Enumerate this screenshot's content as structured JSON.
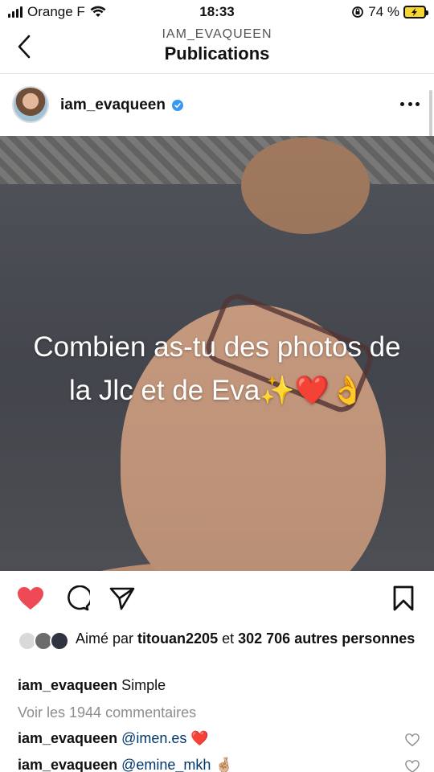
{
  "status_bar": {
    "carrier": "Orange F",
    "time": "18:33",
    "battery": "74 %"
  },
  "header": {
    "subtitle": "IAM_EVAQUEEN",
    "title": "Publications"
  },
  "post": {
    "username": "iam_evaqueen",
    "overlay_text": "Combien as-tu des photos de la Jlc et de Eva✨❤️👌",
    "liked_by_prefix": "Aimé par",
    "liked_by_user": "titouan2205",
    "liked_by_and": "et",
    "liked_by_others": "302 706 autres personnes",
    "caption_user": "iam_evaqueen",
    "caption_text": "Simple",
    "view_comments": "Voir les 1944 commentaires",
    "comments": [
      {
        "user": "iam_evaqueen",
        "mention": "@imen.es",
        "emoji": "❤️"
      },
      {
        "user": "iam_evaqueen",
        "mention": "@emine_mkh",
        "emoji": "🤞🏼"
      }
    ]
  },
  "colors": {
    "like_red": "#ed4956",
    "verified_blue": "#3897f0",
    "muted_gray": "#8e8e8e"
  }
}
